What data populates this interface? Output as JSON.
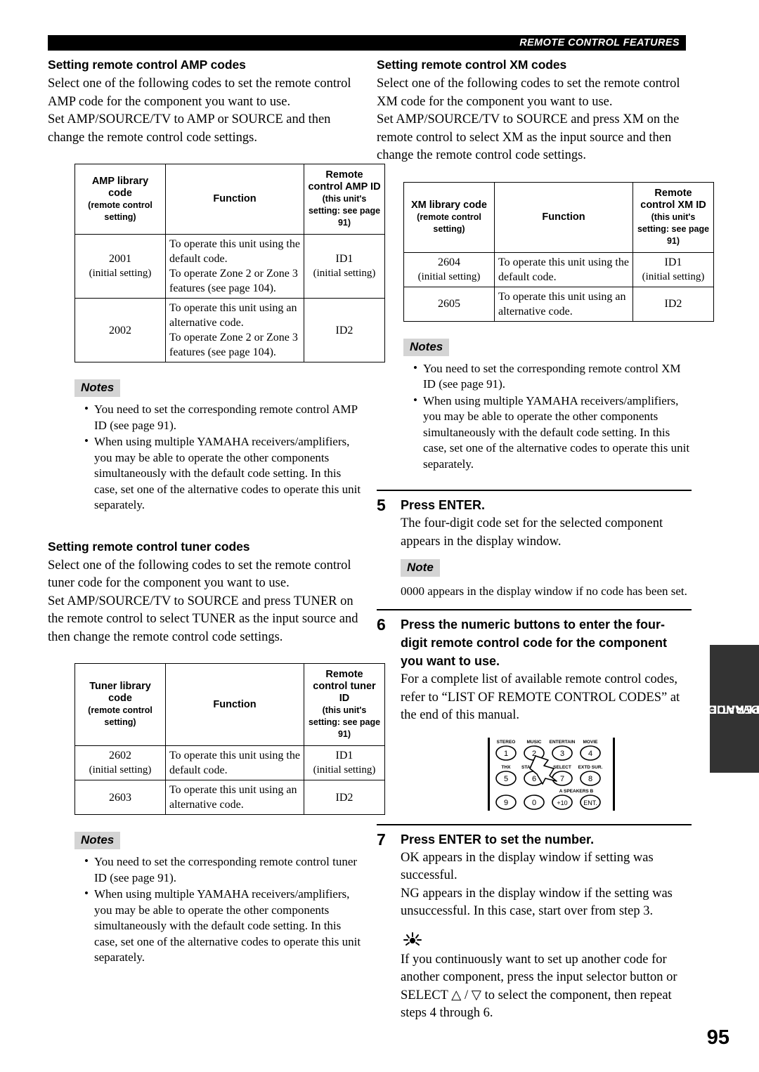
{
  "header": {
    "title": "REMOTE CONTROL FEATURES"
  },
  "side_tab": {
    "line1": "ADVANCED",
    "line2": "OPERATION"
  },
  "page_number": "95",
  "left_column": {
    "amp_section": {
      "title": "Setting remote control AMP codes",
      "intro": "Select one of the following codes to set the remote control AMP code for the component you want to use.",
      "intro2": "Set AMP/SOURCE/TV to AMP or SOURCE and then change the remote control code settings.",
      "table": {
        "headers": {
          "code": "AMP library code",
          "code_sub": "(remote control setting)",
          "function": "Function",
          "id": "Remote control AMP ID",
          "id_sub": "(this unit's setting: see page 91)"
        },
        "rows": [
          {
            "code": "2001",
            "code_sub": "(initial setting)",
            "function_line1": "To operate this unit using the default code.",
            "function_line2": "To operate Zone 2 or Zone 3 features (see page 104).",
            "id": "ID1",
            "id_sub": "(initial setting)"
          },
          {
            "code": "2002",
            "code_sub": "",
            "function_line1": "To operate this unit using an alternative code.",
            "function_line2": "To operate Zone 2 or Zone 3 features (see page 104).",
            "id": "ID2",
            "id_sub": ""
          }
        ]
      },
      "notes_label": "Notes",
      "notes": [
        "You need to set the corresponding remote control AMP ID (see page 91).",
        "When using multiple YAMAHA receivers/amplifiers, you may be able to operate the other components simultaneously with the default code setting. In this case, set one of the alternative codes to operate this unit separately."
      ]
    },
    "tuner_section": {
      "title": "Setting remote control tuner codes",
      "intro": "Select one of the following codes to set the remote control tuner code for the component you want to use.",
      "intro2": "Set AMP/SOURCE/TV to SOURCE and press TUNER on the remote control to select TUNER as the input source and then change the remote control code settings.",
      "table": {
        "headers": {
          "code": "Tuner library code",
          "code_sub": "(remote control setting)",
          "function": "Function",
          "id": "Remote control tuner ID",
          "id_sub": "(this unit's setting: see page 91)"
        },
        "rows": [
          {
            "code": "2602",
            "code_sub": "(initial setting)",
            "function_line1": "To operate this unit using the default code.",
            "function_line2": "",
            "id": "ID1",
            "id_sub": "(initial setting)"
          },
          {
            "code": "2603",
            "code_sub": "",
            "function_line1": "To operate this unit using an alternative code.",
            "function_line2": "",
            "id": "ID2",
            "id_sub": ""
          }
        ]
      },
      "notes_label": "Notes",
      "notes": [
        "You need to set the corresponding remote control tuner ID (see page 91).",
        "When using multiple YAMAHA receivers/amplifiers, you may be able to operate the other components simultaneously with the default code setting. In this case, set one of the alternative codes to operate this unit separately."
      ]
    }
  },
  "right_column": {
    "xm_section": {
      "title": "Setting remote control XM codes",
      "intro": "Select one of the following codes to set the remote control XM code for the component you want to use.",
      "intro2": "Set AMP/SOURCE/TV to SOURCE and press XM on the remote control to select XM as the input source and then change the remote control code settings.",
      "table": {
        "headers": {
          "code": "XM library code",
          "code_sub": "(remote control setting)",
          "function": "Function",
          "id": "Remote control XM ID",
          "id_sub": "(this unit's setting: see page 91)"
        },
        "rows": [
          {
            "code": "2604",
            "code_sub": "(initial setting)",
            "function_line1": "To operate this unit using the default code.",
            "function_line2": "",
            "id": "ID1",
            "id_sub": "(initial setting)"
          },
          {
            "code": "2605",
            "code_sub": "",
            "function_line1": "To operate this unit using an alternative code.",
            "function_line2": "",
            "id": "ID2",
            "id_sub": ""
          }
        ]
      },
      "notes_label": "Notes",
      "notes": [
        "You need to set the corresponding remote control XM ID (see page 91).",
        "When using multiple YAMAHA receivers/amplifiers, you may be able to operate the other components simultaneously with the default code setting. In this case, set one of the alternative codes to operate this unit separately."
      ]
    },
    "steps": [
      {
        "number": "5",
        "heading": "Press ENTER.",
        "text": "The four-digit code set for the selected component appears in the display window.",
        "note_label": "Note",
        "note_text": "0000 appears in the display window if no code has been set."
      },
      {
        "number": "6",
        "heading": "Press the numeric buttons to enter the four-digit remote control code for the component you want to use.",
        "text": "For a complete list of available remote control codes, refer to “LIST OF REMOTE CONTROL CODES” at the end of this manual."
      },
      {
        "number": "7",
        "heading": "Press ENTER to set the number.",
        "text": "OK appears in the display window if setting was successful.",
        "text2": "NG appears in the display window if the setting was unsuccessful. In this case, start over from step 3."
      }
    ],
    "tip": {
      "text": "If you continuously want to set up another code for another component, press the input selector button or SELECT △ / ▽ to select the component, then repeat steps 4 through 6."
    },
    "keypad": {
      "top_labels": [
        "STEREO",
        "MUSIC",
        "ENTERTAIN",
        "MOVIE"
      ],
      "mid_labels": [
        "THX",
        "STANDARD",
        "SELECT",
        "EXTD SUR."
      ],
      "bottom_label": "A  SPEAKERS  B",
      "keys_row1": [
        "1",
        "2",
        "3",
        "4"
      ],
      "keys_row2": [
        "5",
        "6",
        "7",
        "8"
      ],
      "keys_row3": [
        "9",
        "0",
        "+10",
        "ENT."
      ]
    }
  }
}
